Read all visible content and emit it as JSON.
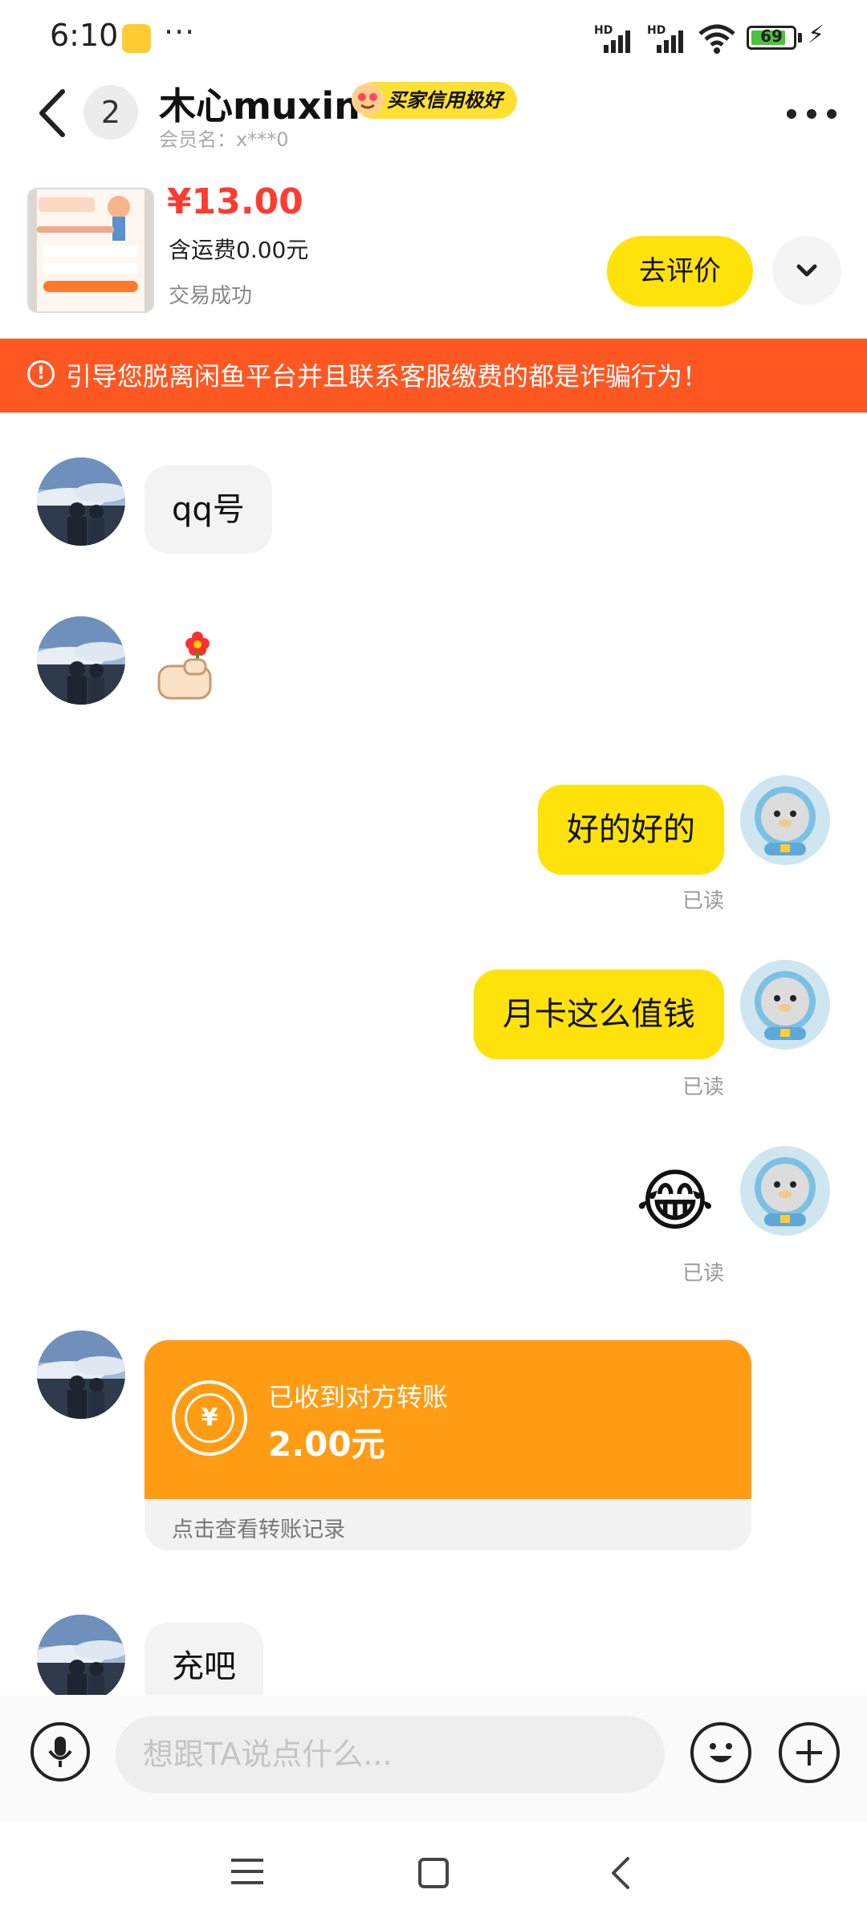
{
  "status_bar": {
    "time": "6:10",
    "more": "···",
    "signal_label_1": "HD",
    "signal_label_2": "HD",
    "battery": "69"
  },
  "header": {
    "unread_count": "2",
    "title": "木心muxin",
    "credit_badge": "买家信用极好",
    "subtitle": "会员名：x***0"
  },
  "product": {
    "price": "¥13.00",
    "shipping": "含运费0.00元",
    "status": "交易成功",
    "review_button": "去评价"
  },
  "warning": {
    "icon": "!",
    "text": "引导您脱离闲鱼平台并且联系客服缴费的都是诈骗行为！"
  },
  "messages": [
    {
      "side": "left",
      "text": "qq号"
    },
    {
      "side": "left",
      "sticker": "thumb-up-flower-icon"
    },
    {
      "side": "right",
      "text": "好的好的",
      "read": "已读"
    },
    {
      "side": "right",
      "text": "月卡这么值钱",
      "read": "已读"
    },
    {
      "side": "right",
      "emoji": "😂",
      "read": "已读"
    },
    {
      "side": "left",
      "text": "充吧"
    }
  ],
  "transfer": {
    "title": "已收到对方转账",
    "amount": "2.00元",
    "link": "点击查看转账记录",
    "currency_symbol": "¥"
  },
  "input": {
    "placeholder": "想跟TA说点什么..."
  },
  "colors": {
    "accent_yellow": "#ffe20a",
    "warning_orange": "#ff5722",
    "transfer_orange": "#ff9c14",
    "price_red": "#ff3b30"
  }
}
